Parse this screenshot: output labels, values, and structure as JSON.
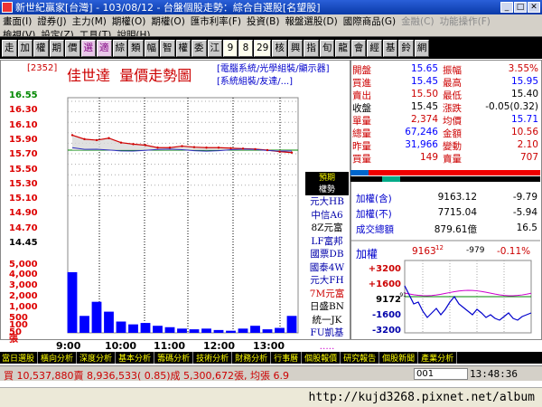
{
  "window": {
    "title": "新世紀贏家[台灣] - 103/08/12 - 台盤個股走勢：綜合自選股[名望股]"
  },
  "menu": {
    "row1": [
      "畫面(I)",
      "證券(J)",
      "主力(M)",
      "期權(O)",
      "期權(O)",
      "匯市利率(F)",
      "投資(B)",
      "報盤選股(D)",
      "國際商品(G)",
      "金融(C)",
      "功能操作(F)"
    ],
    "row2": [
      "檢視(V)",
      "設定(Z)",
      "工具(T)",
      "說明(H)"
    ]
  },
  "toolbar": {
    "buttons": [
      "走",
      "加",
      "權",
      "期",
      "價",
      "選",
      "適",
      "綜",
      "類",
      "幅",
      "智",
      "權",
      "委",
      "江",
      "9",
      "8",
      "29",
      "核",
      "興",
      "指",
      "旬",
      "龍",
      "會",
      "經",
      "基",
      "鈴",
      "網"
    ]
  },
  "chart": {
    "code": "[2352]",
    "name": "佳世達",
    "title": "量價走勢圖",
    "category1": "[電腦系統/光學組裝/顯示器]",
    "category2": "[系統組裝/友達/...]",
    "y_labels": [
      "16.55",
      "16.30",
      "16.10",
      "15.90",
      "15.70",
      "15.50",
      "15.30",
      "15.10",
      "14.90",
      "14.70",
      "14.45"
    ],
    "vol_labels": [
      "5,000",
      "4,000",
      "3,000",
      "2,000",
      "1,000",
      "500",
      "100",
      "50",
      "張"
    ],
    "x_labels": [
      "9:00",
      "10:00",
      "11:00",
      "12:00",
      "13:00"
    ],
    "brokers_header": [
      "預期",
      "權勢"
    ],
    "brokers": [
      "元大HB",
      "中信A6",
      "8Z元富",
      "LF富邦",
      "國票DB",
      "國泰4W",
      "元大FH",
      "7M元富",
      "日盛BN",
      "統一JK",
      "FU凱基",
      "....."
    ]
  },
  "chart_data": {
    "type": "line",
    "title": "量價走勢圖",
    "xlabel": "",
    "ylabel": "",
    "x": [
      "9:00",
      "9:15",
      "9:30",
      "9:45",
      "10:00",
      "10:15",
      "10:30",
      "10:45",
      "11:00",
      "11:15",
      "11:30",
      "11:45",
      "12:00",
      "12:15",
      "12:30",
      "12:45",
      "13:00",
      "13:15",
      "13:30"
    ],
    "series": [
      {
        "name": "price",
        "values": [
          15.8,
          15.72,
          15.7,
          15.74,
          15.65,
          15.62,
          15.6,
          15.55,
          15.55,
          15.58,
          15.56,
          15.55,
          15.55,
          15.54,
          15.53,
          15.52,
          15.5,
          15.47,
          15.45
        ]
      },
      {
        "name": "volume",
        "values": [
          4300,
          1200,
          2200,
          1500,
          800,
          600,
          700,
          500,
          400,
          300,
          250,
          300,
          200,
          150,
          300,
          500,
          250,
          350,
          1200
        ]
      }
    ],
    "ylim": [
      14.45,
      16.55
    ],
    "reference_price": 15.5
  },
  "quote": {
    "rows": [
      {
        "l": "開盤",
        "lv": "15.65",
        "r": "振幅",
        "rv": "3.55%"
      },
      {
        "l": "買進",
        "lv": "15.45",
        "r": "最高",
        "rv": "15.95"
      },
      {
        "l": "賣出",
        "lv": "15.50",
        "r": "最低",
        "rv": "15.40"
      },
      {
        "l": "收盤",
        "lv": "15.45",
        "r": "漲跌",
        "rv": "-0.05(0.32)"
      },
      {
        "l": "單量",
        "lv": "2,374",
        "r": "均價",
        "rv": "15.71"
      },
      {
        "l": "總量",
        "lv": "67,246",
        "r": "金額",
        "rv": "10.56"
      },
      {
        "l": "昨量",
        "lv": "31,966",
        "r": "變動",
        "rv": "2.10"
      },
      {
        "l": "買量",
        "lv": "149",
        "r": "賣量",
        "rv": "707"
      }
    ],
    "index_rows": [
      {
        "l": "加權(含)",
        "v": "9163.12",
        "c": "-9.79"
      },
      {
        "l": "加權(不)",
        "v": "7715.04",
        "c": "-5.94"
      },
      {
        "l": "成交總額",
        "v": "879.61億",
        "c": "16.5"
      }
    ],
    "mini": {
      "label": "加權",
      "value": "9163",
      "value_sub": "12",
      "change": "-979",
      "pct": "-0.11%",
      "y_labels": [
        "+3200",
        "+1600",
        "9172",
        "-1600",
        "-3200"
      ],
      "y_sub": "91"
    }
  },
  "statusbar": {
    "items": [
      "當日選股",
      "橫向分析",
      "深度分析",
      "基本分析",
      "籌碼分析",
      "技術分析",
      "財務分析",
      "行事曆",
      "個股報價",
      "研究報告",
      "個股新聞",
      "產業分析"
    ]
  },
  "bottombar": {
    "text": "買 10,537,880賣 8,936,533( 0.85)成 5,300,672張, 均張 6.9",
    "segment": "001",
    "clock": "13:48:36"
  },
  "taskbar": {
    "url": "http://kujd3268.pixnet.net/album"
  },
  "colors": {
    "price_up": "#d00000",
    "price_line": "#3030c0",
    "volume": "#0000ff"
  }
}
